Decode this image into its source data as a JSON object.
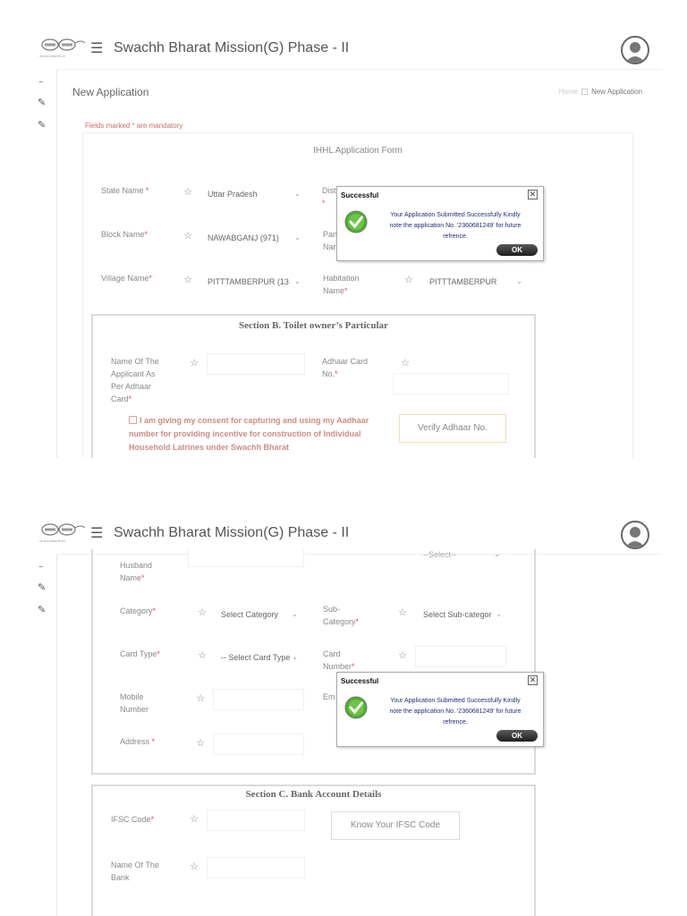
{
  "app": {
    "title": "Swachh Bharat Mission(G) Phase - II",
    "logo_caption": "एक कदम स्वच्छता की ओर"
  },
  "rail": {
    "more": "...",
    "edit_glyph": "✎"
  },
  "page": {
    "title": "New Application",
    "breadcrumb": {
      "home": "Home",
      "current": "New Application"
    },
    "mandatory_note": "Fields marked * are mandatory"
  },
  "form": {
    "title": "IHHL Application Form"
  },
  "location": {
    "state_label": "State Name",
    "state_value": "Uttar Pradesh",
    "district_label": "Dist",
    "district_star": "*",
    "block_label": "Block Name",
    "block_value": "NAWABGANJ (971)",
    "panchayat_label_a": "Pan",
    "panchayat_label_b": "Nar",
    "village_label": "Village Name",
    "village_value": "PITTTAMBERPUR (13",
    "habitation_label_a": "Habitation",
    "habitation_label_b": "Name",
    "habitation_value": "PITTTAMBERPUR"
  },
  "section_b": {
    "title": "Section B. Toilet owner’s Particular",
    "applicant_label": [
      "Name Of The",
      "Applicant As",
      "Per Adhaar",
      "Card"
    ],
    "adhaar_label": [
      "Adhaar Card",
      "No."
    ],
    "consent": "I am giving my consent for capturing and using my Aadhaar number for providing incentive for construction of Individual Household Latrines under Swachh Bharat",
    "verify_button": "Verify Adhaar No.",
    "husband_label": [
      "Husband",
      "Name"
    ],
    "husband_right_value": "--Select--",
    "category_label": "Category",
    "category_value": "Select Category",
    "subcategory_label": [
      "Sub-",
      "Category"
    ],
    "subcategory_value": "Select Sub-categor",
    "cardtype_label": "Card Type",
    "cardtype_value": "-- Select Card Type",
    "cardnumber_label": [
      "Card",
      "Number"
    ],
    "mobile_label": [
      "Mobile",
      "Number"
    ],
    "email_label": "Em",
    "address_label": "Address"
  },
  "section_c": {
    "title": "Section C. Bank Account Details",
    "ifsc_label": "IFSC Code",
    "ifsc_button": "Know Your IFSC Code",
    "bank_label": [
      "Name Of The",
      "Bank"
    ]
  },
  "dialog": {
    "title": "Successful",
    "close": "✕",
    "message_1": "Your Application Submitted Successfully Kindly",
    "message_2": "note the application No. '2360681249' for future",
    "message_3": "refrence.",
    "ok": "OK"
  },
  "icons": {
    "field_icon": "☆",
    "chevron": "⌄"
  }
}
